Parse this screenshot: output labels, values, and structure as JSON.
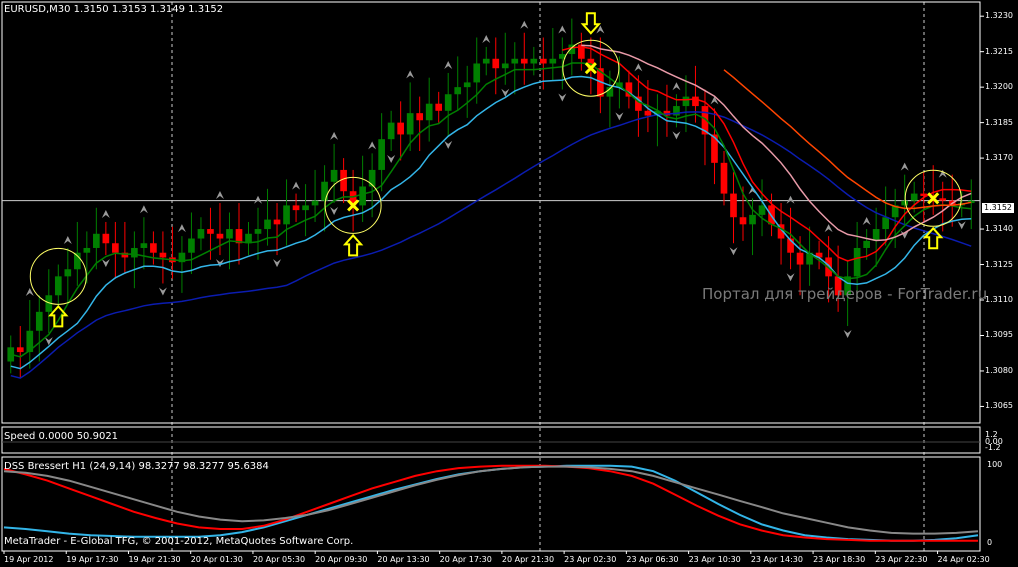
{
  "main_title": "EURUSD,M30  1.3150 1.3153 1.3149 1.3152",
  "speed_title": "Speed 0.0000 50.9021",
  "dss_title": "DSS Bressert H1 (24,9,14) 98.3277 98.3277 95.6384",
  "watermark": "Портал для трейдеров - ForTrader.ru",
  "copyright": "MetaTrader - E-Global TFG, © 2001-2012, MetaQuotes Software Corp.",
  "current_price_label": "1.3152",
  "colors": {
    "bull_candle": "#008000",
    "bear_candle": "#ff0000",
    "ma_green": "#008000",
    "ma_skyblue": "#33b5e8",
    "ma_navy": "#0b1cb0",
    "ma_red": "#ff0000",
    "ma_pink": "#e89aa8",
    "ma_orange": "#ff4500",
    "dss_skyblue": "#33b5e8",
    "dss_red": "#ff0000",
    "dss_gray": "#888888",
    "signal_arrow": "#ffff00",
    "signal_circle": "#ffff66"
  },
  "chart_data": [
    {
      "type": "candlestick",
      "title": "EURUSD,M30  1.3150 1.3153 1.3149 1.3152",
      "x_axis_labels": [
        "19 Apr 2012",
        "19 Apr 17:30",
        "19 Apr 21:30",
        "20 Apr 01:30",
        "20 Apr 05:30",
        "20 Apr 09:30",
        "20 Apr 13:30",
        "20 Apr 17:30",
        "20 Apr 21:30",
        "23 Apr 02:30",
        "23 Apr 06:30",
        "23 Apr 10:30",
        "23 Apr 14:30",
        "23 Apr 18:30",
        "23 Apr 22:30",
        "24 Apr 02:30"
      ],
      "y_axis_labels": [
        "1.3230",
        "1.3215",
        "1.3200",
        "1.3185",
        "1.3170",
        "1.3152",
        "1.3140",
        "1.3125",
        "1.3110",
        "1.3095",
        "1.3080",
        "1.3065"
      ],
      "ylim": [
        1.3058,
        1.3236
      ],
      "candles_approx_close": [
        1.309,
        1.3088,
        1.3097,
        1.3105,
        1.3112,
        1.312,
        1.3123,
        1.313,
        1.3132,
        1.3138,
        1.3134,
        1.313,
        1.3128,
        1.3132,
        1.3134,
        1.313,
        1.3128,
        1.3126,
        1.313,
        1.3136,
        1.314,
        1.3138,
        1.3136,
        1.314,
        1.3134,
        1.3138,
        1.314,
        1.3144,
        1.3142,
        1.315,
        1.3148,
        1.315,
        1.3152,
        1.316,
        1.3165,
        1.3156,
        1.315,
        1.3158,
        1.3165,
        1.3178,
        1.3185,
        1.318,
        1.3189,
        1.3186,
        1.3193,
        1.319,
        1.3197,
        1.32,
        1.3202,
        1.321,
        1.3212,
        1.3208,
        1.321,
        1.3212,
        1.321,
        1.3212,
        1.321,
        1.3212,
        1.3214,
        1.3218,
        1.3212,
        1.3208,
        1.3196,
        1.32,
        1.3202,
        1.3196,
        1.319,
        1.3188,
        1.319,
        1.3188,
        1.3192,
        1.3196,
        1.3192,
        1.318,
        1.3168,
        1.3155,
        1.3145,
        1.3142,
        1.3146,
        1.315,
        1.3142,
        1.3136,
        1.313,
        1.3125,
        1.313,
        1.3128,
        1.312,
        1.3112,
        1.312,
        1.3132,
        1.3135,
        1.314,
        1.3145,
        1.315,
        1.3152,
        1.3155,
        1.3154,
        1.3153,
        1.3152,
        1.315,
        1.3151,
        1.3152
      ],
      "series": [
        {
          "name": "green MA",
          "color": "#008000"
        },
        {
          "name": "sky blue MA",
          "color": "#33b5e8"
        },
        {
          "name": "navy MA",
          "color": "#0b1cb0"
        },
        {
          "name": "red MA",
          "color": "#ff0000"
        },
        {
          "name": "pink MA",
          "color": "#e89aa8"
        },
        {
          "name": "orange MA",
          "color": "#ff4500"
        }
      ],
      "signals": [
        {
          "type": "buy",
          "index": 5
        },
        {
          "type": "buy",
          "index": 36
        },
        {
          "type": "sell",
          "index": 61
        },
        {
          "type": "buy",
          "index": 97
        }
      ]
    },
    {
      "type": "line",
      "title": "Speed 0.0000 50.9021",
      "y_axis_labels": [
        "1.2",
        "0.00",
        "-1.2"
      ]
    },
    {
      "type": "line",
      "title": "DSS Bressert H1 (24,9,14) 98.3277 98.3277 95.6384",
      "y_axis_labels": [
        "100",
        "0"
      ],
      "ylim": [
        0,
        100
      ],
      "series": [
        {
          "name": "sky blue",
          "color": "#33b5e8",
          "values": [
            20,
            18,
            15,
            12,
            10,
            9,
            8,
            8,
            8,
            8,
            10,
            14,
            20,
            28,
            36,
            44,
            52,
            60,
            68,
            75,
            82,
            88,
            92,
            95,
            97,
            98,
            99,
            99,
            99,
            98,
            92,
            80,
            65,
            50,
            36,
            24,
            16,
            10,
            7,
            5,
            4,
            3,
            3,
            4,
            6,
            10
          ]
        },
        {
          "name": "red",
          "color": "#ff0000",
          "values": [
            95,
            88,
            80,
            70,
            60,
            50,
            40,
            32,
            25,
            20,
            18,
            18,
            22,
            30,
            40,
            50,
            60,
            70,
            78,
            86,
            92,
            96,
            98,
            99,
            99,
            99,
            98,
            96,
            92,
            86,
            76,
            62,
            48,
            35,
            24,
            16,
            10,
            7,
            5,
            4,
            3,
            3,
            3,
            3,
            3,
            3
          ]
        },
        {
          "name": "gray",
          "color": "#888888",
          "values": [
            92,
            90,
            86,
            80,
            72,
            64,
            56,
            48,
            40,
            34,
            30,
            28,
            29,
            32,
            36,
            42,
            50,
            58,
            66,
            74,
            81,
            87,
            92,
            95,
            97,
            98,
            98,
            97,
            95,
            92,
            86,
            78,
            70,
            62,
            54,
            46,
            38,
            32,
            26,
            20,
            16,
            13,
            12,
            12,
            13,
            15
          ]
        }
      ]
    }
  ]
}
